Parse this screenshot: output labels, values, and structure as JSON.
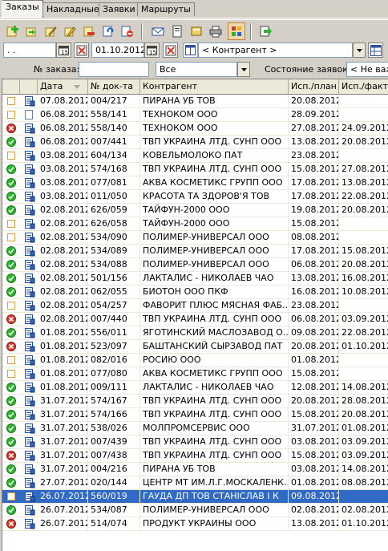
{
  "tabs": [
    "Заказы",
    "Накладные",
    "Заявки",
    "Маршруты"
  ],
  "toolbar": {
    "icons": [
      "add-icon",
      "copy-add-icon",
      "edit-icon",
      "edit-alt-icon",
      "delete-red-icon",
      "refresh-icon",
      "cancel-icon",
      "mail-icon",
      "document-icon",
      "attach-icon",
      "print-icon",
      "settings-icon",
      "export-icon"
    ]
  },
  "filters": {
    "date_from": ". .",
    "date_to": "01.10.2012",
    "type_select": "Все",
    "counterparty": "< Контрагент >",
    "order_no_label": "№ заказа:",
    "order_no_value": "",
    "status_label": "Состояние заявок:",
    "status_value": "< Не важ"
  },
  "columns": {
    "date": "Дата",
    "num": "№ док-та",
    "counterparty": "Контрагент",
    "plan": "Исп./план",
    "fact": "Исп./факт"
  },
  "colors": {
    "green": "#2db52d",
    "red": "#d83a2a",
    "selection": "#316ac5",
    "grey": "#ffffff"
  },
  "rows": [
    {
      "status": "empty",
      "doc": "doc-blue",
      "date": "07.08.2012",
      "num": "004/217",
      "ctr": "ПИРАНА УБ ТОВ",
      "plan": "20.08.2012",
      "fact": ""
    },
    {
      "status": "empty",
      "doc": "doc-blank",
      "date": "06.08.2012",
      "num": "558/141",
      "ctr": "ТЕХНОКОМ ООО",
      "plan": "28.09.2012",
      "fact": ""
    },
    {
      "status": "red",
      "doc": "doc-blue",
      "date": "06.08.2012",
      "num": "558/140",
      "ctr": "ТЕХНОКОМ ООО",
      "plan": "27.08.2012",
      "fact": "24.09.2012"
    },
    {
      "status": "green",
      "doc": "doc-blue",
      "date": "06.08.2012",
      "num": "007/441",
      "ctr": "ТВП УКРАИНА ЛТД. СУНП ООО",
      "plan": "13.08.2012",
      "fact": "20.08.2012"
    },
    {
      "status": "empty",
      "doc": "doc-blue",
      "date": "03.08.2012",
      "num": "604/134",
      "ctr": "КОВЕЛЬМОЛОКО ПАТ",
      "plan": "23.08.2012",
      "fact": ""
    },
    {
      "status": "green",
      "doc": "doc-blue",
      "date": "03.08.2012",
      "num": "574/168",
      "ctr": "ТВП УКРАИНА ЛТД. СУНП ООО",
      "plan": "15.08.2012",
      "fact": "27.08.2012"
    },
    {
      "status": "green",
      "doc": "doc-blue",
      "date": "03.08.2012",
      "num": "077/081",
      "ctr": "АКВА КОСМЕТИКС ГРУПП ООО",
      "plan": "17.08.2012",
      "fact": "13.08.2012"
    },
    {
      "status": "green",
      "doc": "doc-blue",
      "date": "03.08.2012",
      "num": "011/050",
      "ctr": "КРАСОТА ТА ЗДОРОВ'Я ТОВ",
      "plan": "17.08.2012",
      "fact": "22.08.2012"
    },
    {
      "status": "green",
      "doc": "doc-blue",
      "date": "02.08.2012",
      "num": "626/059",
      "ctr": "ТАЙФУН-2000 ООО",
      "plan": "19.08.2012",
      "fact": "20.08.2012"
    },
    {
      "status": "empty",
      "doc": "doc-blue",
      "date": "02.08.2012",
      "num": "626/058",
      "ctr": "ТАЙФУН-2000 ООО",
      "plan": "15.08.2012",
      "fact": ""
    },
    {
      "status": "empty",
      "doc": "doc-blue",
      "date": "02.08.2012",
      "num": "534/090",
      "ctr": "ПОЛИМЕР-УНИВЕРСАЛ ООО",
      "plan": "08.08.2012",
      "fact": ""
    },
    {
      "status": "green",
      "doc": "doc-blue",
      "date": "02.08.2012",
      "num": "534/089",
      "ctr": "ПОЛИМЕР-УНИВЕРСАЛ ООО",
      "plan": "17.08.2012",
      "fact": "15.08.2012"
    },
    {
      "status": "green",
      "doc": "doc-blue",
      "date": "02.08.2012",
      "num": "534/088",
      "ctr": "ПОЛИМЕР-УНИВЕРСАЛ ООО",
      "plan": "06.08.2012",
      "fact": "20.08.2012"
    },
    {
      "status": "green",
      "doc": "doc-blue",
      "date": "02.08.2012",
      "num": "501/156",
      "ctr": "ЛАКТАЛИС - НИКОЛАЕВ ЧАО",
      "plan": "13.08.2012",
      "fact": "16.08.2012"
    },
    {
      "status": "green",
      "doc": "doc-blue",
      "date": "02.08.2012",
      "num": "062/055",
      "ctr": "БИОТОН ООО ПКФ",
      "plan": "16.08.2012",
      "fact": "10.08.2012"
    },
    {
      "status": "empty",
      "doc": "doc-blue",
      "date": "02.08.2012",
      "num": "054/257",
      "ctr": "ФАВОРИТ ПЛЮС МЯСНАЯ ФАБ...",
      "plan": "23.08.2012",
      "fact": ""
    },
    {
      "status": "red",
      "doc": "doc-blue",
      "date": "02.08.2012",
      "num": "007/440",
      "ctr": "ТВП УКРАИНА ЛТД. СУНП ООО",
      "plan": "06.08.2012",
      "fact": "03.09.2012"
    },
    {
      "status": "green",
      "doc": "doc-blue",
      "date": "01.08.2012",
      "num": "556/011",
      "ctr": "ЯГОТИНСКИЙ МАСЛОЗАВОД О...",
      "plan": "09.08.2012",
      "fact": "22.08.2012"
    },
    {
      "status": "red",
      "doc": "doc-blue",
      "date": "01.08.2012",
      "num": "523/097",
      "ctr": "БАШТАНСКИЙ СЫРЗАВОД ПАТ",
      "plan": "20.08.2012",
      "fact": "01.10.2012"
    },
    {
      "status": "empty",
      "doc": "doc-blue",
      "date": "01.08.2012",
      "num": "082/016",
      "ctr": "РОСИЮ ООО",
      "plan": "01.08.2012",
      "fact": ""
    },
    {
      "status": "empty",
      "doc": "doc-blue",
      "date": "01.08.2012",
      "num": "077/080",
      "ctr": "АКВА КОСМЕТИКС ГРУПП ООО",
      "plan": "15.08.2012",
      "fact": ""
    },
    {
      "status": "green",
      "doc": "doc-blue",
      "date": "01.08.2012",
      "num": "009/111",
      "ctr": "ЛАКТАЛИС - НИКОЛАЕВ ЧАО",
      "plan": "12.08.2012",
      "fact": "14.08.2012"
    },
    {
      "status": "green",
      "doc": "doc-blue",
      "date": "31.07.2012",
      "num": "574/167",
      "ctr": "ТВП УКРАИНА ЛТД. СУНП ООО",
      "plan": "20.08.2012",
      "fact": "28.08.2012"
    },
    {
      "status": "green",
      "doc": "doc-blue",
      "date": "31.07.2012",
      "num": "574/166",
      "ctr": "ТВП УКРАИНА ЛТД. СУНП ООО",
      "plan": "15.08.2012",
      "fact": "20.08.2012"
    },
    {
      "status": "green",
      "doc": "doc-blue",
      "date": "31.07.2012",
      "num": "538/026",
      "ctr": "МОЛПРОМСЕРВИС ООО",
      "plan": "31.07.2012",
      "fact": "01.08.2012"
    },
    {
      "status": "green",
      "doc": "doc-blue",
      "date": "31.07.2012",
      "num": "007/439",
      "ctr": "ТВП УКРАИНА ЛТД. СУНП ООО",
      "plan": "03.08.2012",
      "fact": "03.09.2012"
    },
    {
      "status": "red",
      "doc": "doc-blue",
      "date": "31.07.2012",
      "num": "007/438",
      "ctr": "ТВП УКРАИНА ЛТД. СУНП ООО",
      "plan": "15.08.2012",
      "fact": "03.09.2012"
    },
    {
      "status": "green",
      "doc": "doc-blue",
      "date": "31.07.2012",
      "num": "004/216",
      "ctr": "ПИРАНА УБ ТОВ",
      "plan": "03.08.2012",
      "fact": "14.08.2012"
    },
    {
      "status": "green",
      "doc": "doc-blue",
      "date": "27.07.2012",
      "num": "020/144",
      "ctr": "ЦЕНТР МТ ИМ.Л.Г.МОСКАЛЕНК...",
      "plan": "01.08.2012",
      "fact": "08.08.2012"
    },
    {
      "status": "empty",
      "doc": "doc-blue",
      "date": "26.07.2012",
      "num": "560/019",
      "ctr": "ГАУДА ДП ТОВ  СТАНІСЛАВ І К",
      "plan": "09.08.2012",
      "fact": "",
      "selected": true
    },
    {
      "status": "green",
      "doc": "doc-blue",
      "date": "26.07.2012",
      "num": "534/087",
      "ctr": "ПОЛИМЕР-УНИВЕРСАЛ ООО",
      "plan": "02.08.2012",
      "fact": "02.08.2012"
    },
    {
      "status": "red",
      "doc": "doc-blue",
      "date": "26.07.2012",
      "num": "514/074",
      "ctr": "ПРОДУКТ УКРАИНЫ ООО",
      "plan": "13.08.2012",
      "fact": "01.10.2012"
    }
  ]
}
